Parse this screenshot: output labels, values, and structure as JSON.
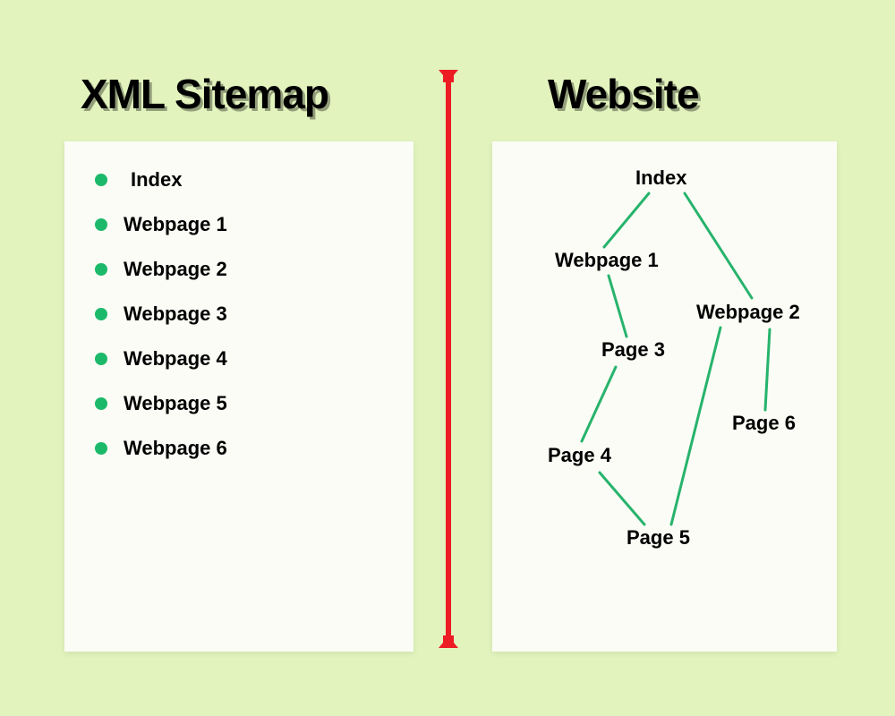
{
  "headings": {
    "left": "XML Sitemap",
    "right": "Website"
  },
  "list_items": [
    "Index",
    "Webpage 1",
    "Webpage 2",
    "Webpage 3",
    "Webpage 4",
    "Webpage 5",
    "Webpage 6"
  ],
  "tree_nodes": {
    "index": "Index",
    "webpage1": "Webpage 1",
    "webpage2": "Webpage 2",
    "page3": "Page 3",
    "page4": "Page 4",
    "page5": "Page 5",
    "page6": "Page 6"
  },
  "colors": {
    "background": "#e2f3bd",
    "panel": "#fafcf5",
    "divider": "#ed1c24",
    "bullet": "#1db96b",
    "edge": "#27b36c"
  }
}
